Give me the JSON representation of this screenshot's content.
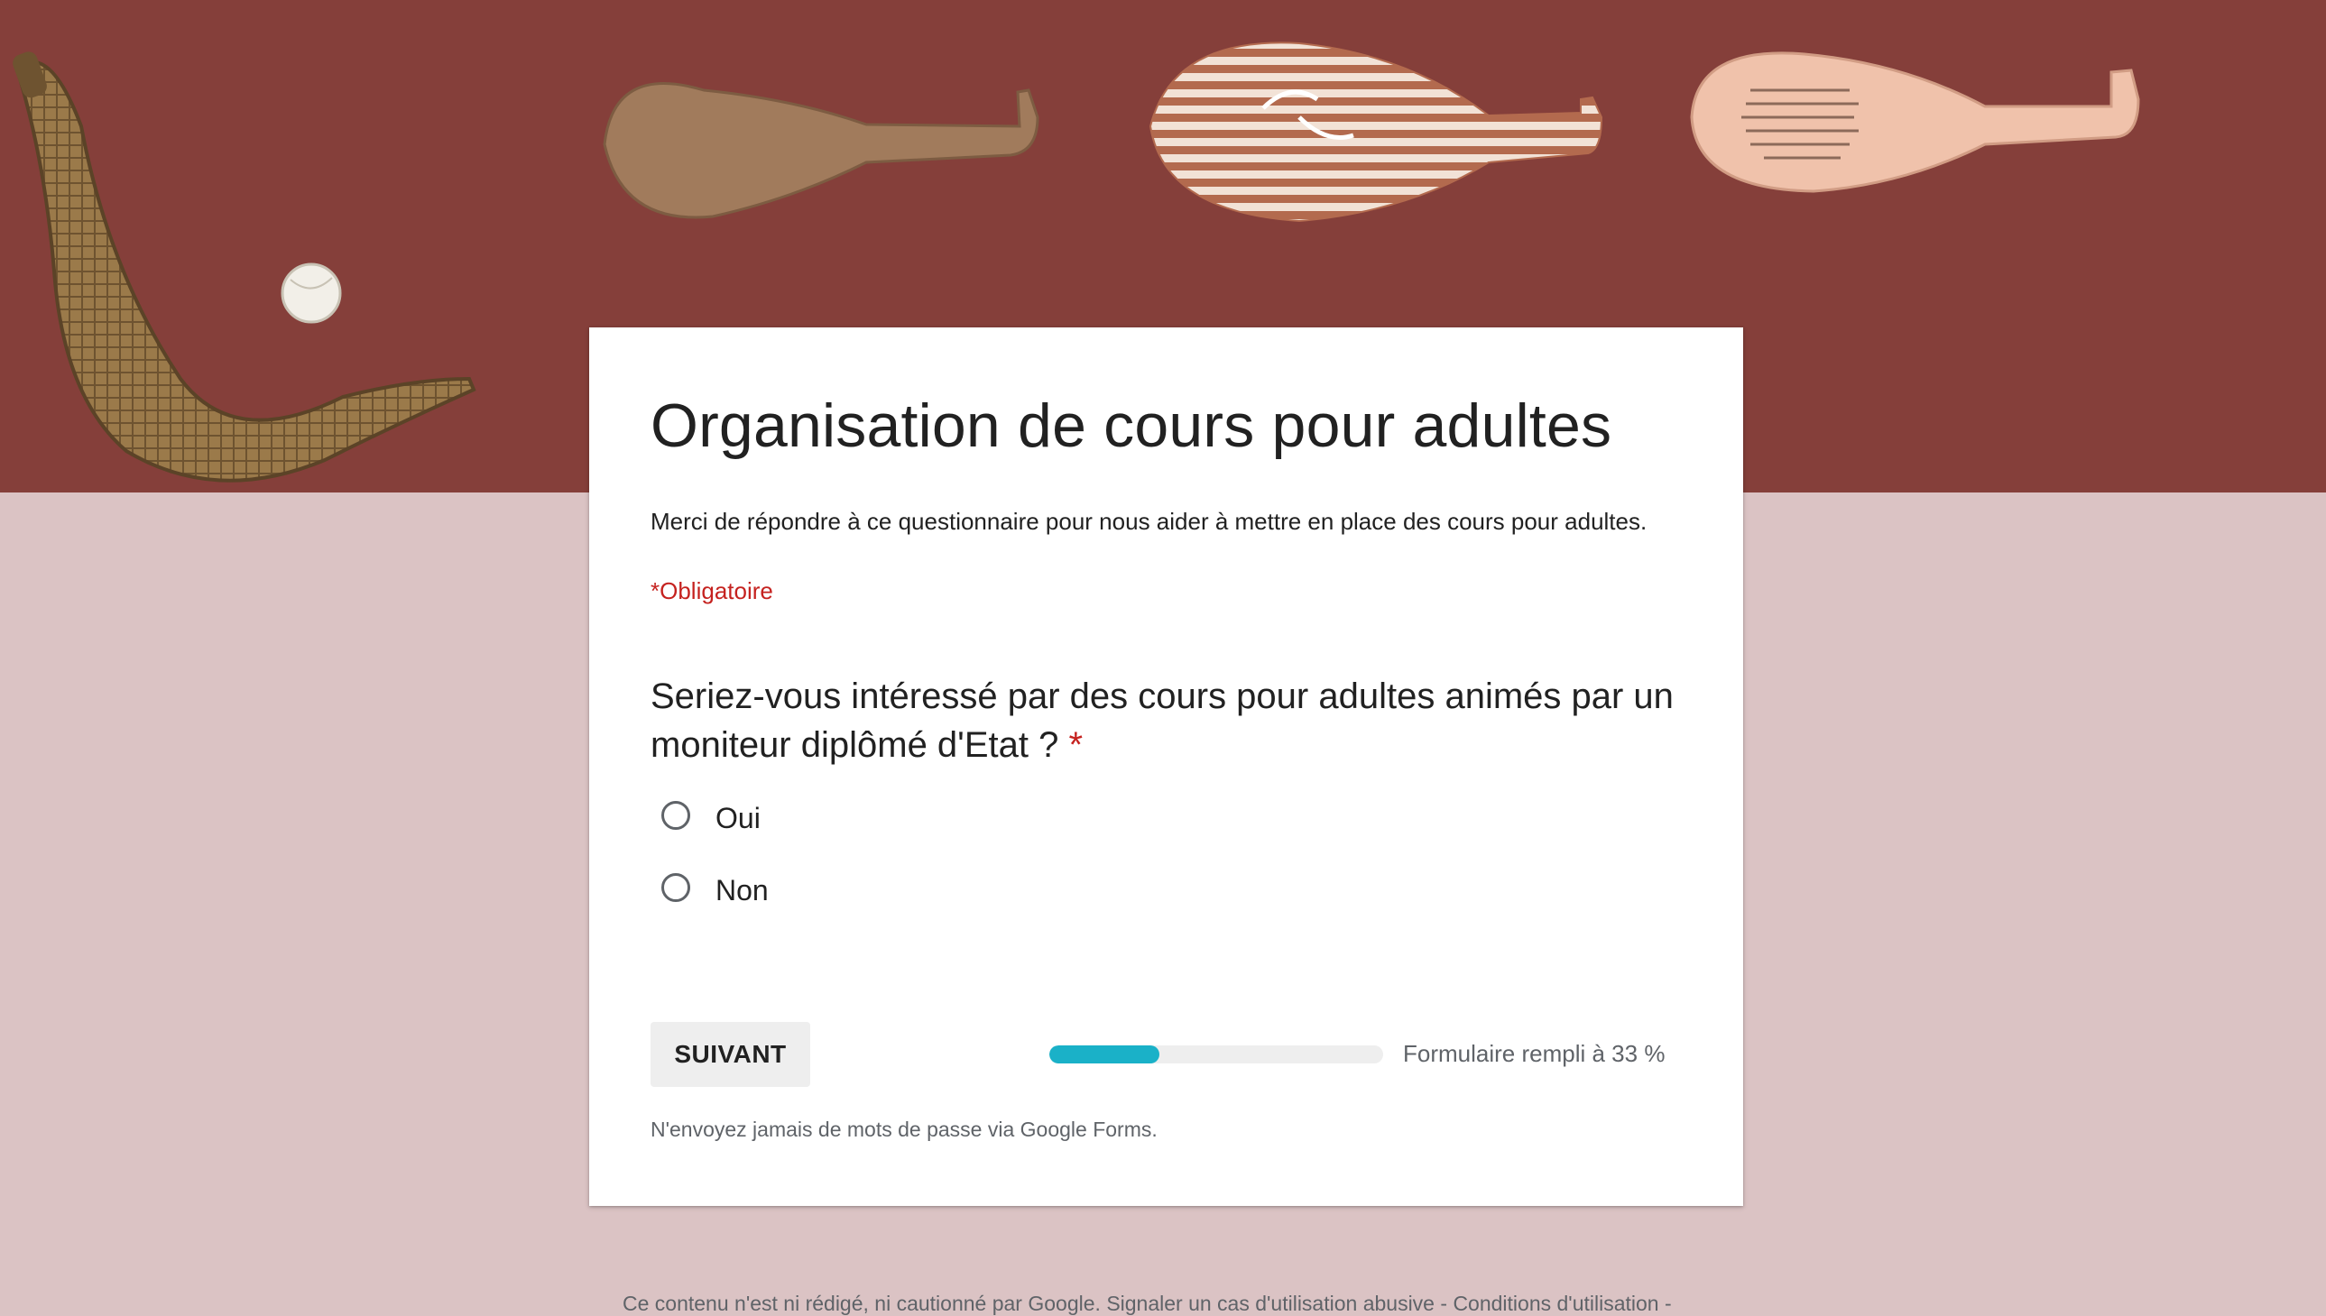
{
  "form": {
    "title": "Organisation de cours pour adultes",
    "description": "Merci de répondre à ce questionnaire pour nous aider à mettre en place des cours pour adultes.",
    "required_note": "*Obligatoire"
  },
  "question": {
    "text": "Seriez-vous intéressé par des cours pour adultes animés par un moniteur diplômé d'Etat ?",
    "required_marker": "*",
    "options": [
      {
        "label": "Oui",
        "selected": false
      },
      {
        "label": "Non",
        "selected": false
      }
    ]
  },
  "navigation": {
    "next_label": "SUIVANT"
  },
  "progress": {
    "percent": 33,
    "label": "Formulaire rempli à 33 %"
  },
  "warning": "N'envoyez jamais de mots de passe via Google Forms.",
  "footer": {
    "text": "Ce contenu n'est ni rédigé, ni cautionné par Google.",
    "report_link": "Signaler un cas d'utilisation abusive",
    "separator": "-",
    "terms_link": "Conditions d'utilisation",
    "trailing": "-"
  },
  "colors": {
    "banner": "#853f3a",
    "page_background": "#dbc3c4",
    "progress_fill": "#1ab1c8",
    "required": "#c5221f"
  }
}
